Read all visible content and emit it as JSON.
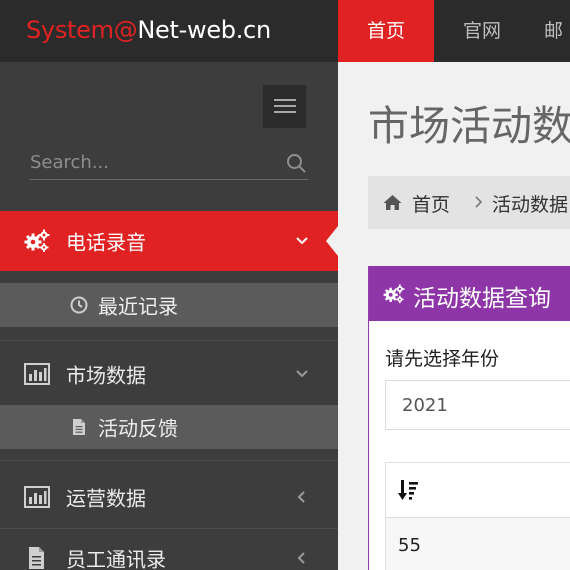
{
  "logo": {
    "part1": "System@",
    "part2": "Net-web.cn"
  },
  "topnav": [
    {
      "label": "首页",
      "active": true
    },
    {
      "label": "官网",
      "active": false
    },
    {
      "label": "邮",
      "active": false
    }
  ],
  "sidebar": {
    "search": {
      "placeholder": "Search...",
      "value": ""
    },
    "items": [
      {
        "label": "电话录音",
        "icon": "cogs-icon",
        "active": true,
        "expanded": true,
        "children": [
          {
            "label": "最近记录",
            "icon": "clock-icon"
          }
        ]
      },
      {
        "label": "市场数据",
        "icon": "bar-chart-icon",
        "active": false,
        "expanded": true,
        "children": [
          {
            "label": "活动反馈",
            "icon": "file-icon"
          }
        ]
      },
      {
        "label": "运营数据",
        "icon": "bar-chart-icon",
        "active": false,
        "expanded": false
      },
      {
        "label": "员工通讯录",
        "icon": "file-icon",
        "active": false,
        "expanded": false
      }
    ]
  },
  "main": {
    "page_title": "市场活动数据",
    "breadcrumb": {
      "home": "首页",
      "current": "活动数据"
    },
    "portlet": {
      "title": "活动数据查询",
      "field_label": "请先选择年份",
      "year_value": "2021",
      "table": {
        "sort_icon": "sort-desc-icon",
        "rows": [
          "55"
        ]
      }
    }
  },
  "colors": {
    "accent": "#e02222",
    "topbar": "#2b2b2b",
    "sidebar": "#3d3d3d",
    "portlet": "#8e35a8"
  }
}
